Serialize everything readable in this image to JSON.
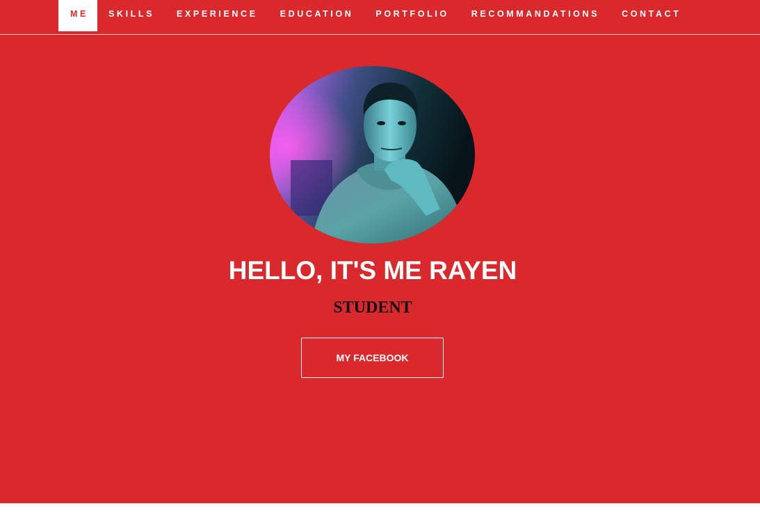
{
  "nav": {
    "items": [
      {
        "label": "ME",
        "active": true
      },
      {
        "label": "SKILLS"
      },
      {
        "label": "EXPERIENCE"
      },
      {
        "label": "EDUCATION"
      },
      {
        "label": "PORTFOLIO"
      },
      {
        "label": "RECOMMANDATIONS"
      },
      {
        "label": "CONTACT"
      }
    ]
  },
  "hero": {
    "title": "HELLO, IT'S ME RAYEN",
    "subtitle": "STUDENT",
    "button_label": "MY FACEBOOK"
  },
  "colors": {
    "hero_background": "#d9292d",
    "text": "#ffffff",
    "subtitle": "#111111"
  },
  "icons": {
    "avatar": "profile-photo"
  }
}
